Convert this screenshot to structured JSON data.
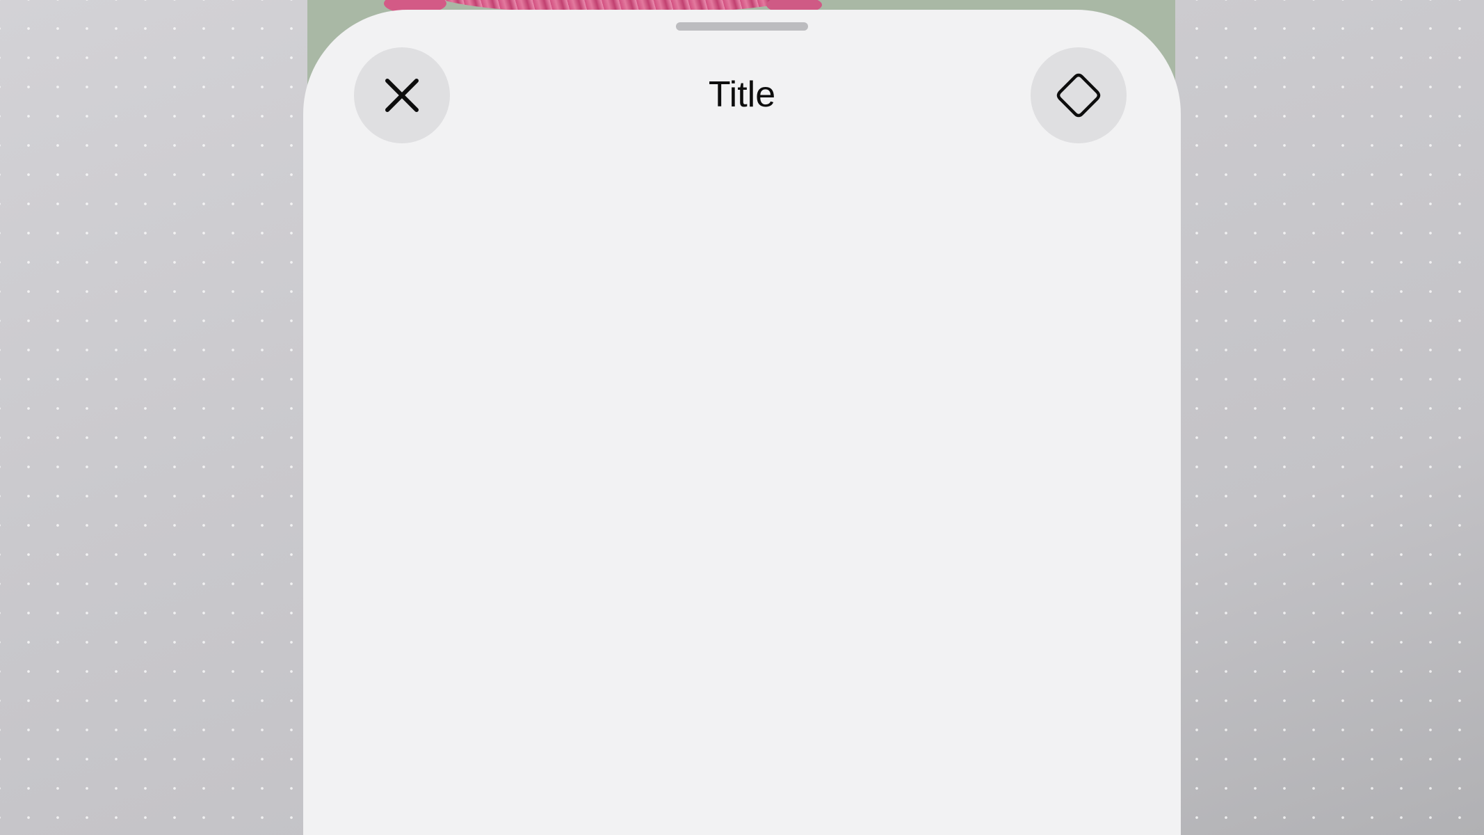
{
  "header": {
    "title": "Title"
  },
  "icons": {
    "close": "close-icon",
    "shape": "diamond-icon"
  },
  "colors": {
    "sheet_background": "#f2f2f3",
    "button_background": "#dfdfe1",
    "icon_color": "#0d0d0d",
    "grabber": "#bcbcbf"
  }
}
